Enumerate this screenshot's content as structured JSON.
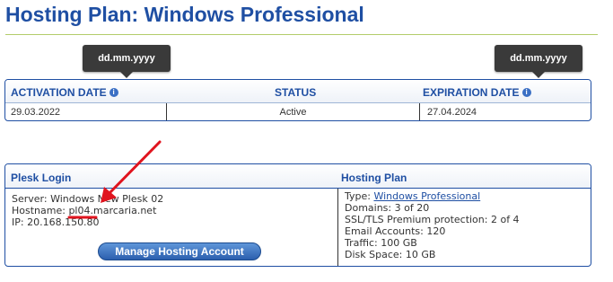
{
  "page": {
    "title": "Hosting Plan: Windows Professional"
  },
  "tooltips": {
    "activation": "dd.mm.yyyy",
    "expiration": "dd.mm.yyyy"
  },
  "dates_table": {
    "headers": {
      "activation": "ACTIVATION DATE",
      "status": "STATUS",
      "expiration": "EXPIRATION DATE"
    },
    "values": {
      "activation": "29.03.2022",
      "status": "Active",
      "expiration": "27.04.2024"
    }
  },
  "details": {
    "plesk_header": "Plesk Login",
    "plan_header": "Hosting Plan",
    "plesk": {
      "server": "Server: Windows New Plesk 02",
      "hostname_label": "Hostname: ",
      "hostname_value": "pl04.marcaria.net",
      "ip": "IP: 20.168.150.80",
      "button": "Manage Hosting Account"
    },
    "plan": {
      "type_label": "Type: ",
      "type_value": "Windows Professional",
      "domains": "Domains: 3 of 20",
      "ssl": "SSL/TLS Premium protection: 2 of 4",
      "email": "Email Accounts: 120",
      "traffic": "Traffic: 100 GB",
      "disk": "Disk Space: 10 GB"
    }
  },
  "colors": {
    "primary": "#1f4fa3",
    "accent_rule": "#b3cc6a",
    "annotation": "#e0141e",
    "tooltip_bg": "#3a3a3a"
  },
  "icons": {
    "info": "info-circle-icon"
  }
}
